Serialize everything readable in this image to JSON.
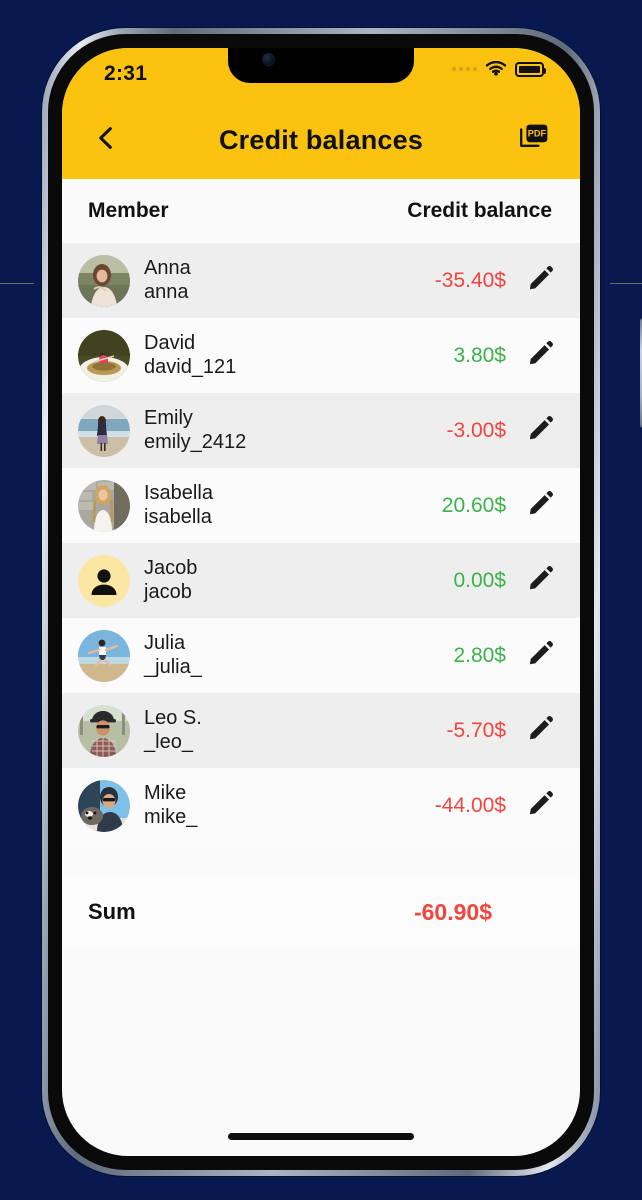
{
  "status_bar": {
    "time": "2:31",
    "signal_icon": "cellular-dots-icon",
    "wifi_icon": "wifi-icon",
    "battery_icon": "battery-full-icon"
  },
  "app_bar": {
    "back_icon": "chevron-left-icon",
    "title": "Credit balances",
    "pdf_icon": "pdf-export-icon",
    "pdf_label": "PDF"
  },
  "table": {
    "headers": {
      "member": "Member",
      "balance": "Credit balance"
    },
    "rows": [
      {
        "name": "Anna",
        "handle": "anna",
        "amount": "-35.40$",
        "sign": "neg",
        "avatar": "photo"
      },
      {
        "name": "David",
        "handle": "david_121",
        "amount": "3.80$",
        "sign": "pos",
        "avatar": "photo"
      },
      {
        "name": "Emily",
        "handle": "emily_2412",
        "amount": "-3.00$",
        "sign": "neg",
        "avatar": "photo"
      },
      {
        "name": "Isabella",
        "handle": "isabella",
        "amount": "20.60$",
        "sign": "pos",
        "avatar": "photo"
      },
      {
        "name": "Jacob",
        "handle": "jacob",
        "amount": "0.00$",
        "sign": "pos",
        "avatar": "placeholder"
      },
      {
        "name": "Julia",
        "handle": "_julia_",
        "amount": "2.80$",
        "sign": "pos",
        "avatar": "photo"
      },
      {
        "name": "Leo S.",
        "handle": "_leo_",
        "amount": "-5.70$",
        "sign": "neg",
        "avatar": "photo"
      },
      {
        "name": "Mike",
        "handle": "mike_",
        "amount": "-44.00$",
        "sign": "neg",
        "avatar": "photo"
      }
    ],
    "edit_icon": "pencil-edit-icon"
  },
  "summary": {
    "label": "Sum",
    "value": "-60.90$"
  },
  "colors": {
    "accent_yellow": "#FBC310",
    "negative_red": "#F1453D",
    "positive_green": "#3EB24A",
    "page_background": "#07194F",
    "row_alt": "#EEEEEE",
    "avatar_placeholder_bg": "#FBE6A4"
  },
  "home_indicator": "home-indicator"
}
